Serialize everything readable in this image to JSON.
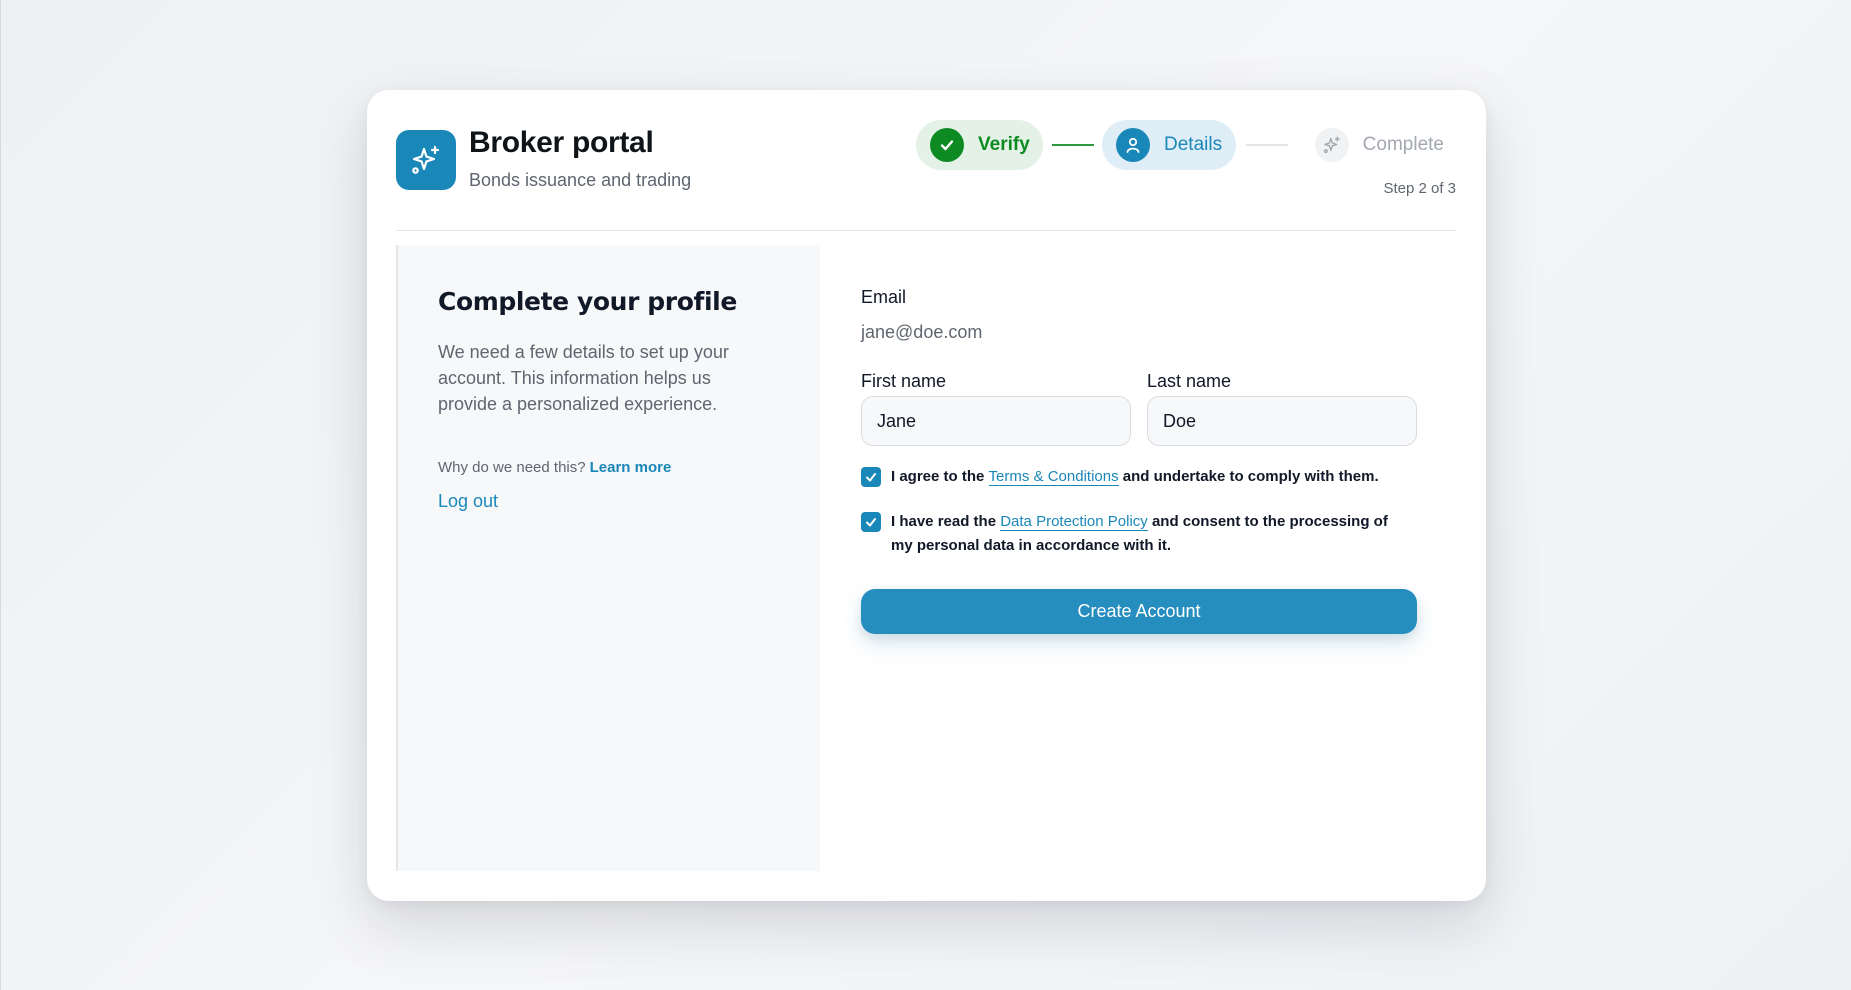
{
  "app": {
    "title": "Broker portal",
    "subtitle": "Bonds issuance and trading",
    "logo_icon": "sparkles-icon",
    "brand_color": "#1a87b9"
  },
  "stepper": {
    "steps": [
      {
        "label": "Verify",
        "state": "done",
        "icon": "check-icon",
        "color": "#0e8a23"
      },
      {
        "label": "Details",
        "state": "active",
        "icon": "user-icon",
        "color": "#1a87b9"
      },
      {
        "label": "Complete",
        "state": "pending",
        "icon": "sparkles-icon",
        "color": "#a3a8b0"
      }
    ],
    "step_count": "Step 2 of 3"
  },
  "sidebar": {
    "title": "Complete your profile",
    "description": "We need a few details to set up your account. This information helps us provide a personalized experience.",
    "why_text": "Why do we need this?",
    "learn_more": "Learn more",
    "logout": "Log out"
  },
  "form": {
    "email_label": "Email",
    "email_value": "jane@doe.com",
    "first_name_label": "First name",
    "first_name_value": "Jane",
    "last_name_label": "Last name",
    "last_name_value": "Doe",
    "terms": {
      "checked": true,
      "prefix": "I agree to the",
      "link": "Terms & Conditions",
      "suffix": "and undertake to comply with them."
    },
    "privacy": {
      "checked": true,
      "prefix": "I have read the",
      "link": "Data Protection Policy",
      "suffix": "and consent to the processing of my personal data in accordance with it."
    },
    "submit_label": "Create Account"
  }
}
